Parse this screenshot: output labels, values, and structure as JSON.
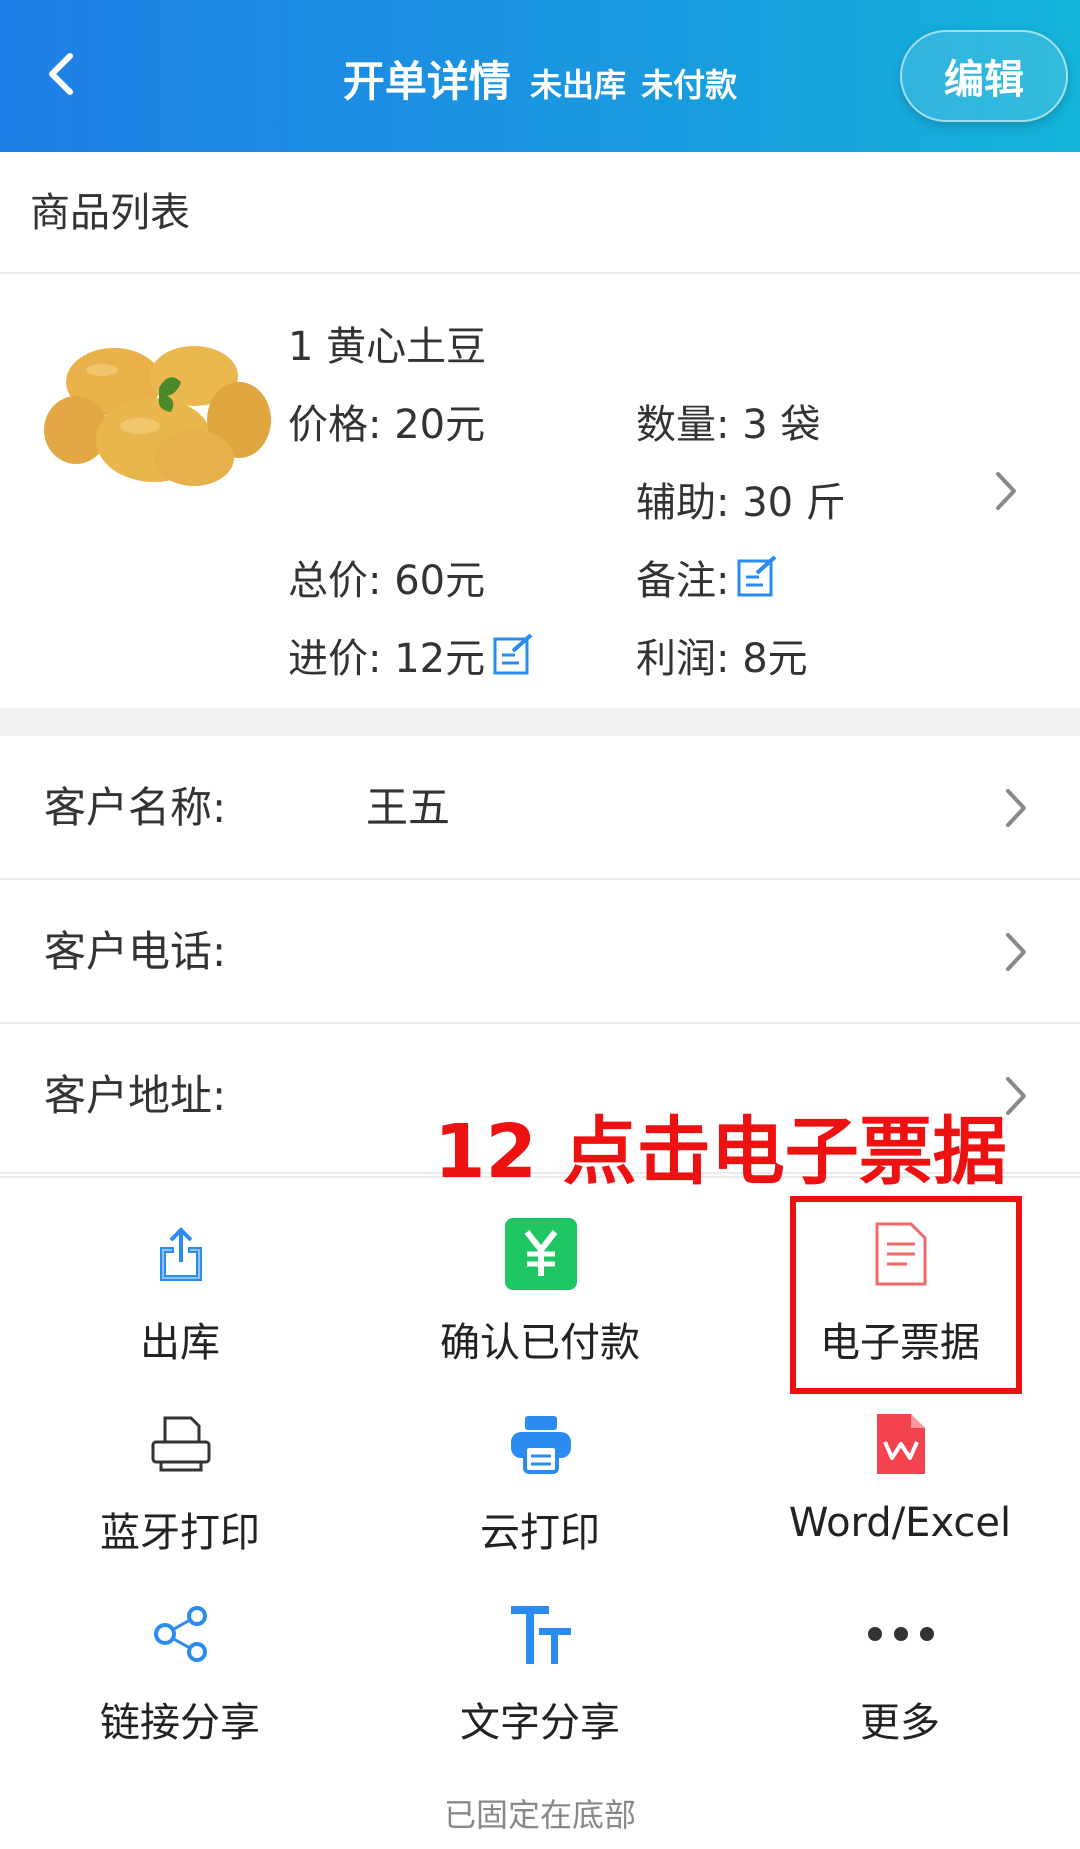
{
  "header": {
    "title": "开单详情",
    "status_outbound": "未出库",
    "status_payment": "未付款",
    "edit_label": "编辑",
    "gradient_start": "#1f7fe6",
    "gradient_end": "#14b4d9"
  },
  "section_title": "商品列表",
  "product": {
    "name": "1 黄心土豆",
    "price": "价格: 20元",
    "quantity": "数量: 3 袋",
    "auxiliary": "辅助: 30 斤",
    "total": "总价: 60元",
    "note": "备注:",
    "cost": "进价: 12元",
    "profit": "利润: 8元"
  },
  "customer": {
    "name_label": "客户名称:",
    "name_value": "王五",
    "phone_label": "客户电话:",
    "address_label": "客户地址:"
  },
  "annotation": "12 点击电子票据",
  "actions": [
    {
      "label": "出库",
      "icon": "upload-icon"
    },
    {
      "label": "确认已付款",
      "icon": "yuan-icon"
    },
    {
      "label": "电子票据",
      "icon": "document-icon"
    },
    {
      "label": "蓝牙打印",
      "icon": "printer-outline-icon"
    },
    {
      "label": "云打印",
      "icon": "cloud-printer-icon"
    },
    {
      "label": "Word/Excel",
      "icon": "wps-file-icon"
    },
    {
      "label": "链接分享",
      "icon": "share-icon"
    },
    {
      "label": "文字分享",
      "icon": "text-size-icon"
    },
    {
      "label": "更多",
      "icon": "more-icon"
    }
  ],
  "footer": "已固定在底部",
  "colors": {
    "accent_blue": "#2a8cf0",
    "green": "#1ec764",
    "red": "#ee1111",
    "wps_red": "#f2434f"
  }
}
